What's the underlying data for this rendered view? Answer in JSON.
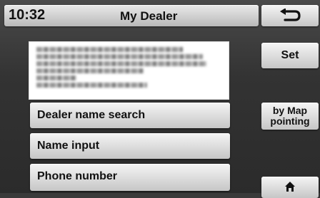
{
  "status_bar": {
    "clock": "10:32",
    "title": "My Dealer"
  },
  "toolbar": {
    "back_icon": "return-arrow-icon",
    "home_icon": "home-icon"
  },
  "dealer_info": {
    "redacted": true
  },
  "menu": {
    "items": [
      {
        "label": "Dealer name search"
      },
      {
        "label": "Name input"
      },
      {
        "label": "Phone number"
      }
    ]
  },
  "side": {
    "set_label": "Set",
    "map_label_line1": "by Map",
    "map_label_line2": "pointing"
  },
  "colors": {
    "background": "#333333",
    "button_face": "#e0e0e0",
    "text": "#111111"
  }
}
